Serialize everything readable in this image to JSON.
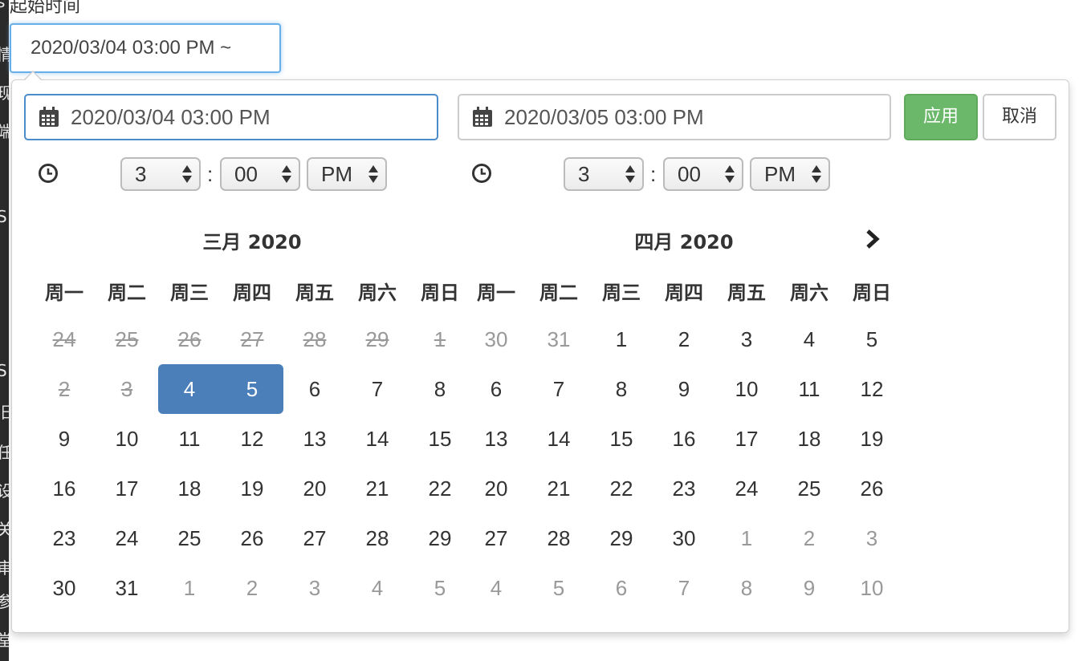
{
  "left_strip": [
    "s",
    "情",
    "现",
    "端",
    "I",
    "S",
    "S",
    "旧",
    "任",
    "设",
    "关",
    "审",
    "参",
    "堂"
  ],
  "field_label": "起始时间",
  "trigger_value": "2020/03/04 03:00 PM ~",
  "start_input": {
    "value": "2020/03/04 03:00 PM",
    "icon": "calendar-icon"
  },
  "end_input": {
    "value": "2020/03/05 03:00 PM",
    "icon": "calendar-icon"
  },
  "buttons": {
    "apply": "应用",
    "cancel": "取消"
  },
  "colors": {
    "apply": "#6cb86a",
    "selected": "#4a7fba",
    "focus_border": "#4a8bc9"
  },
  "start_time": {
    "hour": "3",
    "minute": "00",
    "ampm": "PM",
    "separator": ":"
  },
  "end_time": {
    "hour": "3",
    "minute": "00",
    "ampm": "PM",
    "separator": ":"
  },
  "left_calendar": {
    "title": "三月 2020",
    "weekdays": [
      "周一",
      "周二",
      "周三",
      "周四",
      "周五",
      "周六",
      "周日"
    ],
    "weeks": [
      [
        {
          "d": "24",
          "s": "disabled"
        },
        {
          "d": "25",
          "s": "disabled"
        },
        {
          "d": "26",
          "s": "disabled"
        },
        {
          "d": "27",
          "s": "disabled"
        },
        {
          "d": "28",
          "s": "disabled"
        },
        {
          "d": "29",
          "s": "disabled"
        },
        {
          "d": "1",
          "s": "disabled"
        }
      ],
      [
        {
          "d": "2",
          "s": "disabled"
        },
        {
          "d": "3",
          "s": "disabled"
        },
        {
          "d": "4",
          "s": "active start"
        },
        {
          "d": "5",
          "s": "active end"
        },
        {
          "d": "6",
          "s": ""
        },
        {
          "d": "7",
          "s": ""
        },
        {
          "d": "8",
          "s": ""
        }
      ],
      [
        {
          "d": "9",
          "s": ""
        },
        {
          "d": "10",
          "s": ""
        },
        {
          "d": "11",
          "s": ""
        },
        {
          "d": "12",
          "s": ""
        },
        {
          "d": "13",
          "s": ""
        },
        {
          "d": "14",
          "s": ""
        },
        {
          "d": "15",
          "s": ""
        }
      ],
      [
        {
          "d": "16",
          "s": ""
        },
        {
          "d": "17",
          "s": ""
        },
        {
          "d": "18",
          "s": ""
        },
        {
          "d": "19",
          "s": ""
        },
        {
          "d": "20",
          "s": ""
        },
        {
          "d": "21",
          "s": ""
        },
        {
          "d": "22",
          "s": ""
        }
      ],
      [
        {
          "d": "23",
          "s": ""
        },
        {
          "d": "24",
          "s": ""
        },
        {
          "d": "25",
          "s": ""
        },
        {
          "d": "26",
          "s": ""
        },
        {
          "d": "27",
          "s": ""
        },
        {
          "d": "28",
          "s": ""
        },
        {
          "d": "29",
          "s": ""
        }
      ],
      [
        {
          "d": "30",
          "s": ""
        },
        {
          "d": "31",
          "s": ""
        },
        {
          "d": "1",
          "s": "off"
        },
        {
          "d": "2",
          "s": "off"
        },
        {
          "d": "3",
          "s": "off"
        },
        {
          "d": "4",
          "s": "off"
        },
        {
          "d": "5",
          "s": "off"
        }
      ]
    ]
  },
  "right_calendar": {
    "title": "四月 2020",
    "next_icon": "chevron-right-icon",
    "weekdays": [
      "周一",
      "周二",
      "周三",
      "周四",
      "周五",
      "周六",
      "周日"
    ],
    "weeks": [
      [
        {
          "d": "30",
          "s": "off"
        },
        {
          "d": "31",
          "s": "off"
        },
        {
          "d": "1",
          "s": ""
        },
        {
          "d": "2",
          "s": ""
        },
        {
          "d": "3",
          "s": ""
        },
        {
          "d": "4",
          "s": ""
        },
        {
          "d": "5",
          "s": ""
        }
      ],
      [
        {
          "d": "6",
          "s": ""
        },
        {
          "d": "7",
          "s": ""
        },
        {
          "d": "8",
          "s": ""
        },
        {
          "d": "9",
          "s": ""
        },
        {
          "d": "10",
          "s": ""
        },
        {
          "d": "11",
          "s": ""
        },
        {
          "d": "12",
          "s": ""
        }
      ],
      [
        {
          "d": "13",
          "s": ""
        },
        {
          "d": "14",
          "s": ""
        },
        {
          "d": "15",
          "s": ""
        },
        {
          "d": "16",
          "s": ""
        },
        {
          "d": "17",
          "s": ""
        },
        {
          "d": "18",
          "s": ""
        },
        {
          "d": "19",
          "s": ""
        }
      ],
      [
        {
          "d": "20",
          "s": ""
        },
        {
          "d": "21",
          "s": ""
        },
        {
          "d": "22",
          "s": ""
        },
        {
          "d": "23",
          "s": ""
        },
        {
          "d": "24",
          "s": ""
        },
        {
          "d": "25",
          "s": ""
        },
        {
          "d": "26",
          "s": ""
        }
      ],
      [
        {
          "d": "27",
          "s": ""
        },
        {
          "d": "28",
          "s": ""
        },
        {
          "d": "29",
          "s": ""
        },
        {
          "d": "30",
          "s": ""
        },
        {
          "d": "1",
          "s": "off"
        },
        {
          "d": "2",
          "s": "off"
        },
        {
          "d": "3",
          "s": "off"
        }
      ],
      [
        {
          "d": "4",
          "s": "off"
        },
        {
          "d": "5",
          "s": "off"
        },
        {
          "d": "6",
          "s": "off"
        },
        {
          "d": "7",
          "s": "off"
        },
        {
          "d": "8",
          "s": "off"
        },
        {
          "d": "9",
          "s": "off"
        },
        {
          "d": "10",
          "s": "off"
        }
      ]
    ]
  }
}
